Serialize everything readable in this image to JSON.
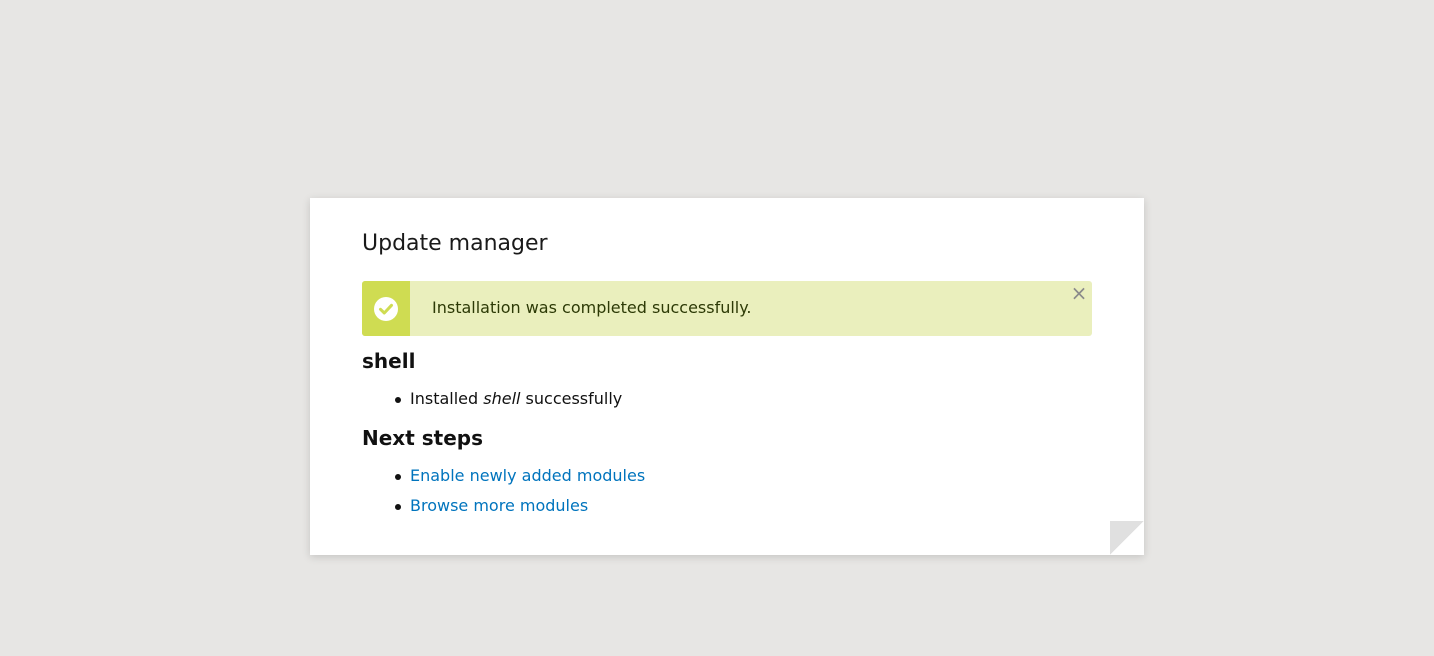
{
  "dialog": {
    "title": "Update manager"
  },
  "status": {
    "icon": "check-circle-icon",
    "message": "Installation was completed successfully.",
    "close_glyph": "×",
    "colors": {
      "icon_bg": "#cfdc52",
      "bg": "#eaefbd",
      "text": "#2d3a06"
    }
  },
  "project": {
    "name": "shell",
    "messages": [
      {
        "before": "Installed ",
        "emphasis": "shell",
        "after": " successfully"
      }
    ]
  },
  "next_steps": {
    "heading": "Next steps",
    "links": [
      {
        "label": "Enable newly added modules"
      },
      {
        "label": "Browse more modules"
      }
    ],
    "link_color": "#0074bd"
  }
}
